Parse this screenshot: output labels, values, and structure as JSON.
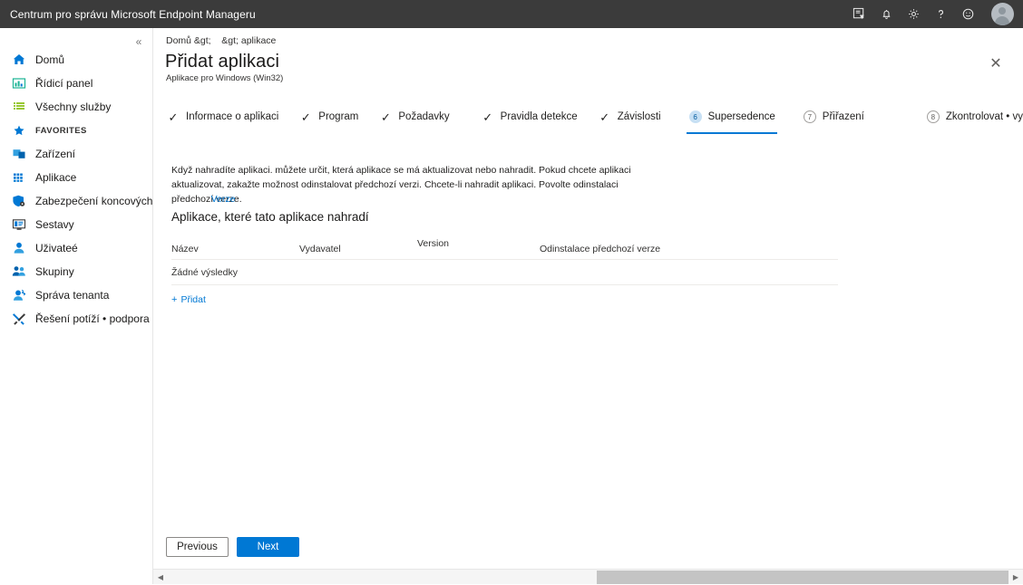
{
  "topbar": {
    "title": "Centrum pro správu Microsoft Endpoint Manageru",
    "icons": [
      {
        "name": "cloud-shell-icon",
        "glyph": "cloud-shell"
      },
      {
        "name": "notifications-bell-icon",
        "glyph": "bell"
      },
      {
        "name": "settings-gear-icon",
        "glyph": "gear"
      },
      {
        "name": "help-question-icon",
        "glyph": "question"
      },
      {
        "name": "feedback-smiley-icon",
        "glyph": "smiley"
      }
    ],
    "avatar_label": "account-avatar"
  },
  "sidebar": {
    "collapse_glyph": "«",
    "items": [
      {
        "label": "Domů",
        "icon": "home-icon",
        "color": "#0078d4"
      },
      {
        "label": "Řídicí panel",
        "icon": "dashboard-icon",
        "color": "#1ab394"
      },
      {
        "label": "Všechny služby",
        "icon": "all-services-icon",
        "color": "#7fba00"
      },
      {
        "label": "FAVORITES",
        "icon": "star-icon",
        "color": "#0078d4"
      },
      {
        "label": "Zařízení",
        "icon": "devices-icon",
        "color": "#0078d4"
      },
      {
        "label": "Aplikace",
        "icon": "apps-grid-icon",
        "color": "#0078d4"
      },
      {
        "label": "Zabezpečení koncových bodů",
        "icon": "endpoint-security-shield-icon",
        "color": "#0078d4"
      },
      {
        "label": "Sestavy",
        "icon": "reports-icon",
        "color": "#0078d4"
      },
      {
        "label": "Uživateé",
        "icon": "users-icon",
        "color": "#0078d4"
      },
      {
        "label": "Skupiny",
        "icon": "groups-icon",
        "color": "#0078d4"
      },
      {
        "label": "Správa tenanta",
        "icon": "tenant-admin-icon",
        "color": "#0078d4"
      },
      {
        "label": "Řešení potíží • podpora",
        "icon": "troubleshooting-wrench-icon",
        "color": "#0078d4"
      }
    ]
  },
  "blade": {
    "breadcrumb": "Domů &gt;    &gt; aplikace",
    "title": "Přidat aplikaci",
    "subtitle": "Aplikace pro Windows (Win32)",
    "close_glyph": "✕"
  },
  "wizard": {
    "tabs": [
      {
        "label": "Informace o aplikaci",
        "state": "completed",
        "step": "1"
      },
      {
        "label": "Program",
        "state": "completed",
        "step": "2"
      },
      {
        "label": "Požadavky",
        "state": "completed",
        "step": "3"
      },
      {
        "label": "Pravidla detekce",
        "state": "completed",
        "step": "4"
      },
      {
        "label": "Závislosti",
        "state": "completed",
        "step": "5"
      },
      {
        "label": "Supersedence",
        "state": "active",
        "step": "6"
      },
      {
        "label": "Přiřazení",
        "state": "pending",
        "step": "7"
      },
      {
        "label": "Zkontrolovat • vytvořit",
        "state": "pending",
        "step": "8"
      }
    ],
    "check_glyph": "✓"
  },
  "content": {
    "description": "Když nahradíte aplikaci. můžete určit, která aplikace se má aktualizovat nebo nahradit. Pokud chcete aplikaci aktualizovat, zakažte možnost odinstalovat předchozí verzi. Chcete-li nahradit aplikaci. Povolte odinstalaci předchozí verze.",
    "description_link": "Verze",
    "section_heading": "Aplikace, které tato aplikace nahradí",
    "table": {
      "columns": [
        "Název",
        "Vydavatel",
        "Version",
        "Odinstalace předchozí verze"
      ],
      "rows": [],
      "empty_text": "Žádné výsledky"
    },
    "add_link": "Přidat",
    "add_plus": "+"
  },
  "footer": {
    "previous_label": "Previous",
    "next_label": "Next",
    "accent_color": "#0078d4"
  },
  "scrollbar": {
    "left_glyph": "◀",
    "right_glyph": "▶"
  }
}
